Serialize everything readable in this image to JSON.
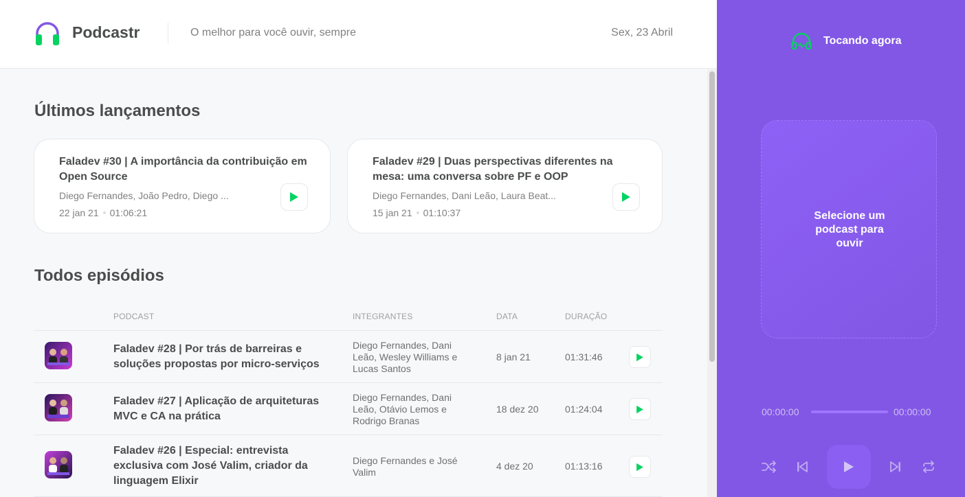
{
  "app": {
    "name": "Podcastr",
    "tagline": "O melhor para você ouvir, sempre",
    "date": "Sex, 23 Abril",
    "accent": "#8257e5",
    "play_color": "#04d361"
  },
  "latest": {
    "title": "Últimos lançamentos",
    "episodes": [
      {
        "title": "Faladev #30 | A importância da contribuição em Open Source",
        "members": "Diego Fernandes, João Pedro, Diego ...",
        "date": "22 jan 21",
        "duration": "01:06:21"
      },
      {
        "title": "Faladev #29 | Duas perspectivas diferentes na mesa: uma conversa sobre PF e OOP",
        "members": "Diego Fernandes, Dani Leão, Laura Beat...",
        "date": "15 jan 21",
        "duration": "01:10:37"
      }
    ]
  },
  "all": {
    "title": "Todos episódios",
    "columns": [
      "Podcast",
      "Integrantes",
      "Data",
      "Duração"
    ],
    "episodes": [
      {
        "title": "Faladev #28 | Por trás de barreiras e soluções propostas por micro-serviços",
        "members": "Diego Fernandes, Dani Leão, Wesley Williams e Lucas Santos",
        "date": "8 jan 21",
        "duration": "01:31:46"
      },
      {
        "title": "Faladev #27 | Aplicação de arquiteturas MVC e CA na prática",
        "members": "Diego Fernandes, Dani Leão, Otávio Lemos e Rodrigo Branas",
        "date": "18 dez 20",
        "duration": "01:24:04"
      },
      {
        "title": "Faladev #26 | Especial: entrevista exclusiva com José Valim, criador da linguagem Elixir",
        "members": "Diego Fernandes e José Valim",
        "date": "4 dez 20",
        "duration": "01:13:16"
      }
    ]
  },
  "player": {
    "now_playing": "Tocando agora",
    "empty_text": "Selecione um podcast para ouvir",
    "current_time": "00:00:00",
    "total_time": "00:00:00"
  }
}
